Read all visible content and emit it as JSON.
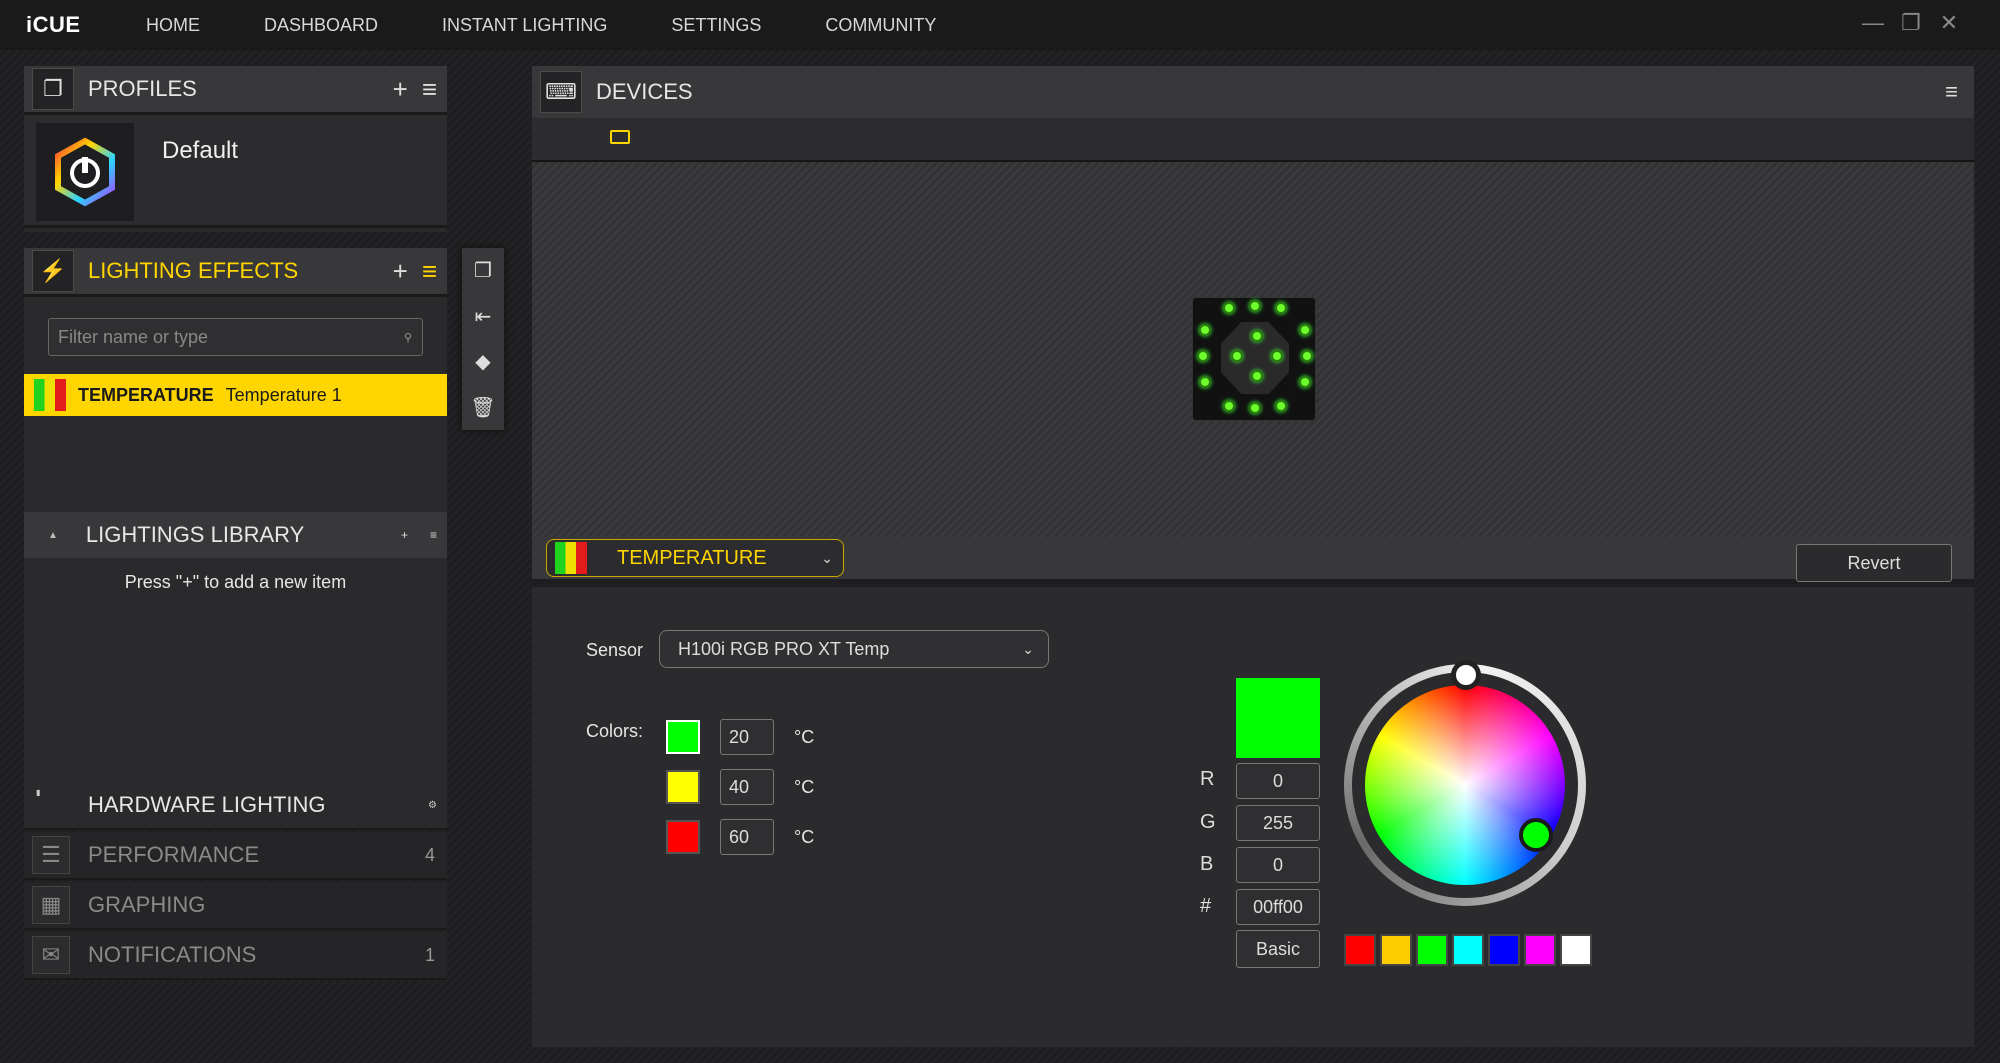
{
  "app": {
    "name": "iCUE"
  },
  "nav": [
    "HOME",
    "DASHBOARD",
    "INSTANT LIGHTING",
    "SETTINGS",
    "COMMUNITY"
  ],
  "profiles": {
    "title": "PROFILES",
    "active": "Default"
  },
  "lighting_effects": {
    "title": "LIGHTING EFFECTS",
    "filter_placeholder": "Filter name or type",
    "items": [
      {
        "type": "TEMPERATURE",
        "name": "Temperature 1"
      }
    ]
  },
  "library": {
    "title": "LIGHTINGS LIBRARY",
    "empty_text": "Press \"+\" to add a new item"
  },
  "hardware": {
    "title": "HARDWARE LIGHTING"
  },
  "performance": {
    "title": "PERFORMANCE",
    "count": "4"
  },
  "graphing": {
    "title": "GRAPHING"
  },
  "notifications": {
    "title": "NOTIFICATIONS",
    "count": "1"
  },
  "devices": {
    "title": "DEVICES"
  },
  "effect": {
    "selected": "TEMPERATURE",
    "revert_label": "Revert",
    "sensor_label": "Sensor",
    "sensor_value": "H100i RGB PRO XT Temp",
    "colors_label": "Colors:",
    "unit": "°C",
    "thresholds": [
      {
        "color": "#00ff00",
        "value": "20"
      },
      {
        "color": "#ffff00",
        "value": "40"
      },
      {
        "color": "#ff0000",
        "value": "60"
      }
    ]
  },
  "picker": {
    "r_label": "R",
    "r": "0",
    "g_label": "G",
    "g": "255",
    "b_label": "B",
    "b": "0",
    "hex_label": "#",
    "hex": "00ff00",
    "basic_label": "Basic",
    "preview_color": "#00ff00",
    "presets": [
      "#ff0000",
      "#ffcc00",
      "#00ff00",
      "#00ffff",
      "#0000ff",
      "#ff00ff",
      "#ffffff"
    ]
  },
  "icons": {
    "profiles": "copy-icon",
    "lighting": "lightning-icon",
    "devices": "keyboard-icon"
  }
}
